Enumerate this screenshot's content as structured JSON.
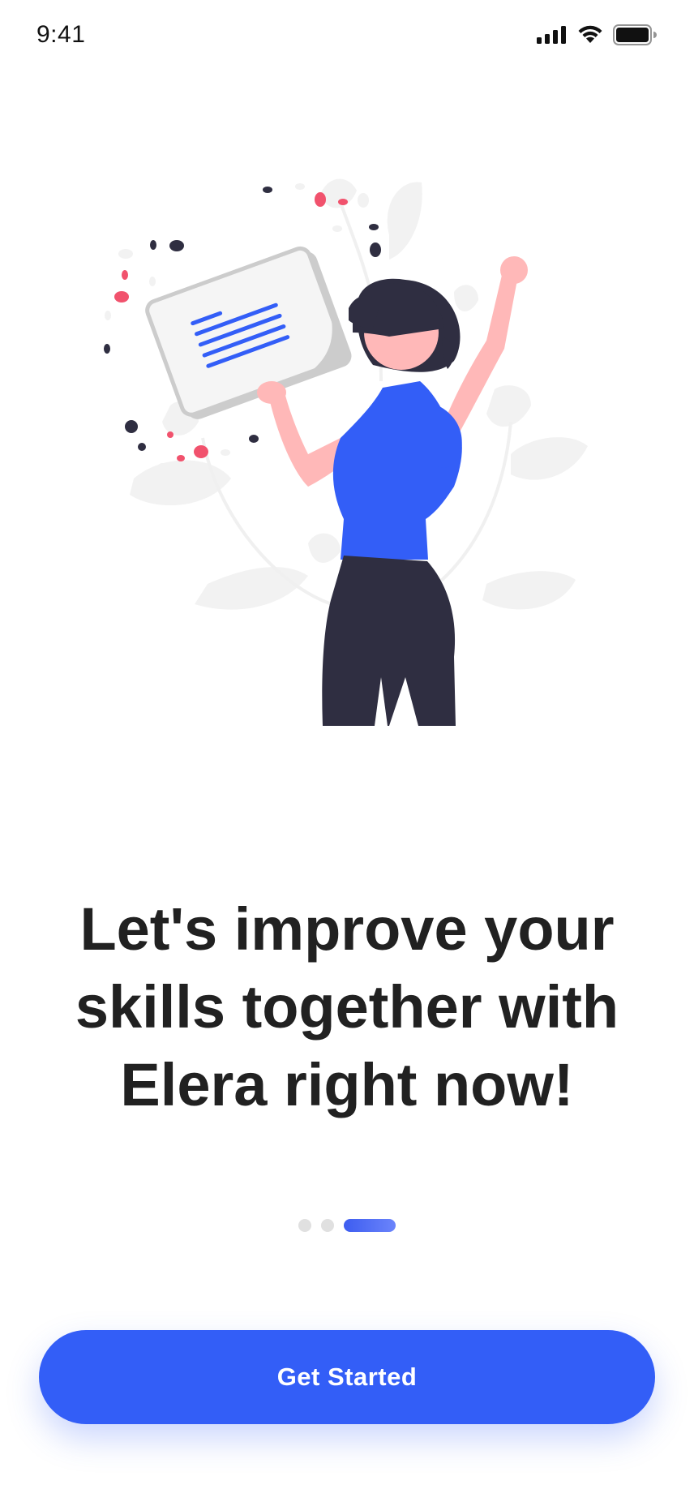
{
  "status_bar": {
    "time": "9:41",
    "icons": [
      "signal-icon",
      "wifi-icon",
      "battery-icon"
    ]
  },
  "onboarding": {
    "headline": "Let's improve your skills together with Elera right now!",
    "pager": {
      "total_pages": 3,
      "active_index": 2
    }
  },
  "cta": {
    "label": "Get Started"
  },
  "colors": {
    "primary": "#335EF7",
    "text": "#212121",
    "dot_inactive": "#E0E0E0",
    "illustration_dark": "#2F2E41",
    "illustration_skin": "#FFB8B8",
    "illustration_accent": "#F1526D"
  }
}
